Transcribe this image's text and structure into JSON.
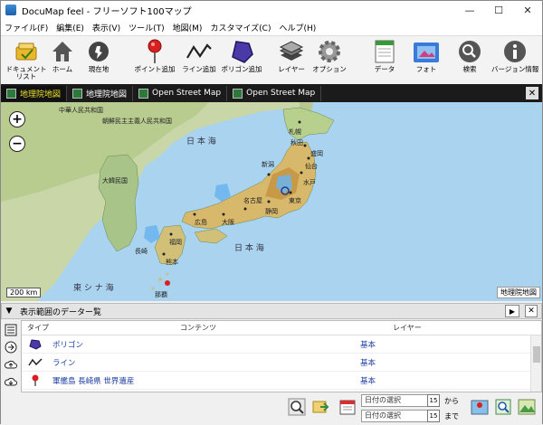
{
  "window": {
    "title": "DocuMap feel - フリーソフト100マップ",
    "controls": {
      "minimize": "—",
      "maximize": "☐",
      "close": "✕"
    }
  },
  "menu": [
    "ファイル(F)",
    "編集(E)",
    "表示(V)",
    "ツール(T)",
    "地図(M)",
    "カスタマイズ(C)",
    "ヘルプ(H)"
  ],
  "toolbar": [
    {
      "label": "ドキュメント\nリスト",
      "icon": "document-list-icon"
    },
    {
      "label": "ホーム",
      "icon": "home-icon"
    },
    {
      "label": "現在地",
      "icon": "current-location-icon"
    },
    {
      "label": "ポイント追加",
      "icon": "add-point-icon"
    },
    {
      "label": "ライン追加",
      "icon": "add-line-icon"
    },
    {
      "label": "ポリゴン追加",
      "icon": "add-polygon-icon"
    },
    {
      "label": "レイヤー",
      "icon": "layer-icon"
    },
    {
      "label": "オプション",
      "icon": "options-gear-icon"
    },
    {
      "label": "データ",
      "icon": "data-icon"
    },
    {
      "label": "フォト",
      "icon": "photo-icon"
    },
    {
      "label": "検索",
      "icon": "search-icon"
    },
    {
      "label": "バージョン情報",
      "icon": "info-icon"
    }
  ],
  "tabs": [
    {
      "label": "地理院地図",
      "active": true
    },
    {
      "label": "地理院地図",
      "active": false
    },
    {
      "label": "Open Street Map",
      "active": false
    },
    {
      "label": "Open Street Map",
      "active": false
    }
  ],
  "map": {
    "scale_label": "200 km",
    "attribution": "地理院地図",
    "sea_labels": [
      "日 本 海",
      "日 本 海",
      "東 シ ナ 海"
    ],
    "zoom_in": "+",
    "zoom_out": "−",
    "place_labels": [
      "中華人民共和国",
      "朝鮮民主主義人民共和国",
      "大韓民国",
      "札幌",
      "秋田",
      "盛岡",
      "仙台",
      "新潟",
      "水戸",
      "東京",
      "静岡",
      "名古屋",
      "大阪",
      "広島",
      "福岡",
      "長崎",
      "熊本",
      "那覇"
    ]
  },
  "panel": {
    "title": "表示範囲のデーター覧",
    "toggle": "▼",
    "play": "▶",
    "close": "✕",
    "columns": {
      "type": "タイプ",
      "content": "コンテンツ",
      "layer": "レイヤー"
    },
    "rows": [
      {
        "type_icon": "polygon-icon",
        "content": "ポリゴン",
        "layer": "基本"
      },
      {
        "type_icon": "line-icon",
        "content": "ライン",
        "layer": "基本"
      },
      {
        "type_icon": "pin-icon",
        "content": "軍艦島 長崎県 世界遺産",
        "layer": "基本"
      }
    ]
  },
  "date_filter": {
    "from_placeholder": "日付の選択",
    "to_placeholder": "日付の選択",
    "from_suffix": "から",
    "to_suffix": "まで",
    "calendar_day": "15"
  }
}
